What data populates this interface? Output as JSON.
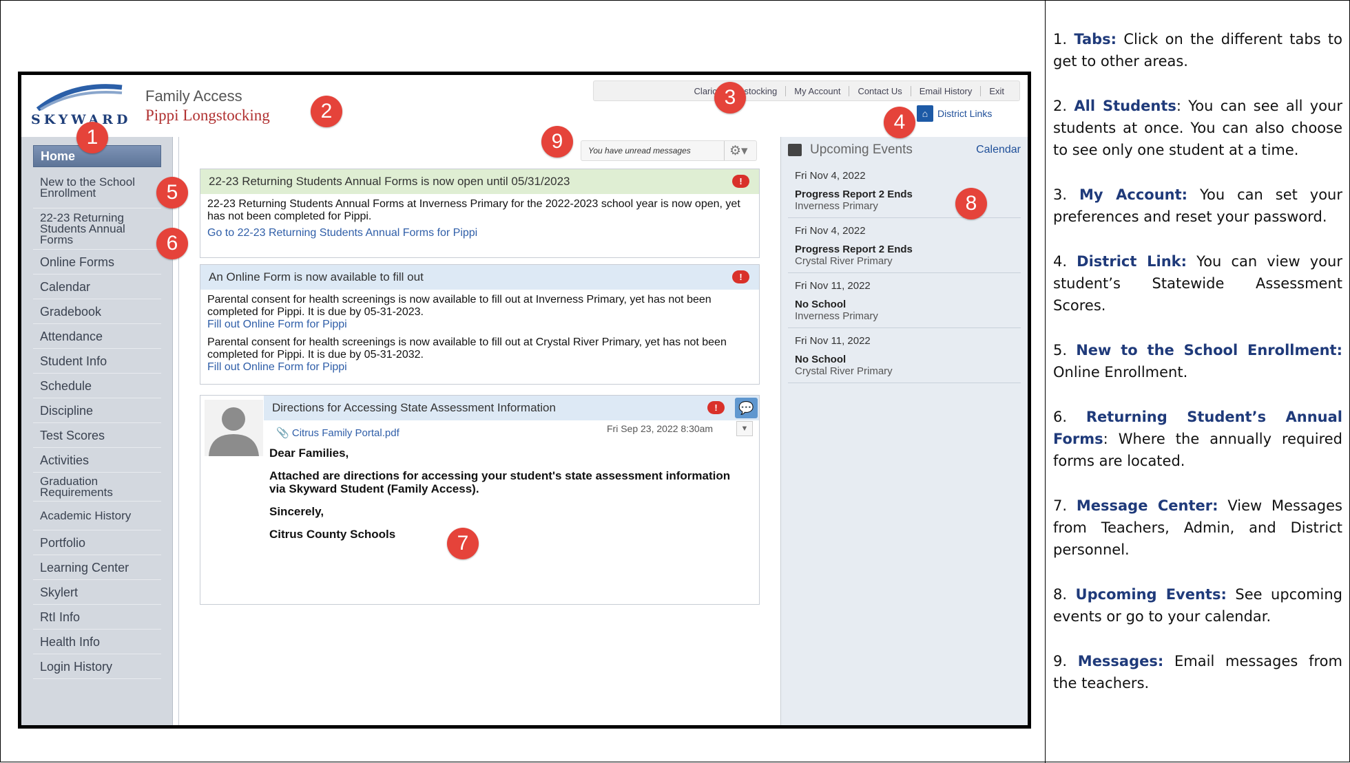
{
  "header": {
    "logo_text": "SKYWARD",
    "app_title": "Family Access",
    "student_name": "Pippi Longstocking",
    "top_links": [
      "Clarice Longstocking",
      "My Account",
      "Contact Us",
      "Email History",
      "Exit"
    ],
    "district_links": "District Links"
  },
  "messages_bar": {
    "text": "You have unread messages"
  },
  "sidebar": {
    "items": [
      {
        "label": "Home"
      },
      {
        "label": "New to the School Enrollment"
      },
      {
        "label": "22-23 Returning Students Annual Forms"
      },
      {
        "label": "Online Forms"
      },
      {
        "label": "Calendar"
      },
      {
        "label": "Gradebook"
      },
      {
        "label": "Attendance"
      },
      {
        "label": "Student Info"
      },
      {
        "label": "Schedule"
      },
      {
        "label": "Discipline"
      },
      {
        "label": "Test Scores"
      },
      {
        "label": "Activities"
      },
      {
        "label": "Graduation Requirements"
      },
      {
        "label": "Academic History"
      },
      {
        "label": "Portfolio"
      },
      {
        "label": "Learning Center"
      },
      {
        "label": "Skylert"
      },
      {
        "label": "RtI Info"
      },
      {
        "label": "Health Info"
      },
      {
        "label": "Login History"
      }
    ]
  },
  "panel1": {
    "title": "22-23 Returning Students Annual Forms is now open until 05/31/2023",
    "body": "22-23 Returning Students Annual Forms at Inverness Primary for the 2022-2023 school year is now open, yet has not been completed for Pippi.",
    "link": "Go to 22-23 Returning Students Annual Forms for Pippi"
  },
  "panel2": {
    "title": "An Online Form is now available to fill out",
    "item1": "Parental consent for health screenings is now available to fill out at Inverness Primary, yet has not been completed for Pippi.  It is due by 05-31-2023.",
    "link1": "Fill out Online Form for Pippi",
    "item2": "Parental consent for health screenings is now available to fill out at Crystal River Primary, yet has not been completed for Pippi.  It is due by 05-31-2032.",
    "link2": "Fill out Online Form for Pippi"
  },
  "panel3": {
    "title": "Directions for Accessing State Assessment Information",
    "attachment": "Citrus Family Portal.pdf",
    "date": "Fri Sep 23, 2022 8:30am",
    "greeting": "Dear Families,",
    "body": "Attached are directions for accessing your student's state assessment information via Skyward Student (Family Access).",
    "closing": "Sincerely,",
    "signature": "Citrus County Schools"
  },
  "events": {
    "title": "Upcoming Events",
    "calendar_link": "Calendar",
    "items": [
      {
        "date": "Fri Nov 4, 2022",
        "title": "Progress Report 2 Ends",
        "school": "Inverness Primary"
      },
      {
        "date": "Fri Nov 4, 2022",
        "title": "Progress Report 2 Ends",
        "school": "Crystal River Primary"
      },
      {
        "date": "Fri Nov 11, 2022",
        "title": "No School",
        "school": "Inverness Primary"
      },
      {
        "date": "Fri Nov 11, 2022",
        "title": "No School",
        "school": "Crystal River Primary"
      }
    ]
  },
  "callouts": [
    "1",
    "2",
    "3",
    "4",
    "5",
    "6",
    "7",
    "8",
    "9"
  ],
  "notes": [
    {
      "num": "1.",
      "title": "Tabs:",
      "text": "Click on the different tabs to get to other areas."
    },
    {
      "num": "2.",
      "title": "All Students",
      "text": ": You can see all your students at once. You can also choose to see only one student at a time."
    },
    {
      "num": "3.",
      "title": "My Account:",
      "text": "You can set your preferences and reset your password."
    },
    {
      "num": "4.",
      "title": "District Link:",
      "text": "You can view your student’s Statewide Assessment Scores."
    },
    {
      "num": "5.",
      "title": "New to the School Enrollment:",
      "text": "Online Enrollment."
    },
    {
      "num": "6.",
      "title": "Returning Student’s Annual Forms",
      "text": ": Where the annually required forms are located."
    },
    {
      "num": "7.",
      "title": "Message Center:",
      "text": "View Messages from Teachers, Admin, and District personnel."
    },
    {
      "num": "8.",
      "title": "Upcoming Events:",
      "text": "See upcoming events or go to your calendar."
    },
    {
      "num": "9.",
      "title": "Messages:",
      "text": "Email messages from the teachers."
    }
  ]
}
